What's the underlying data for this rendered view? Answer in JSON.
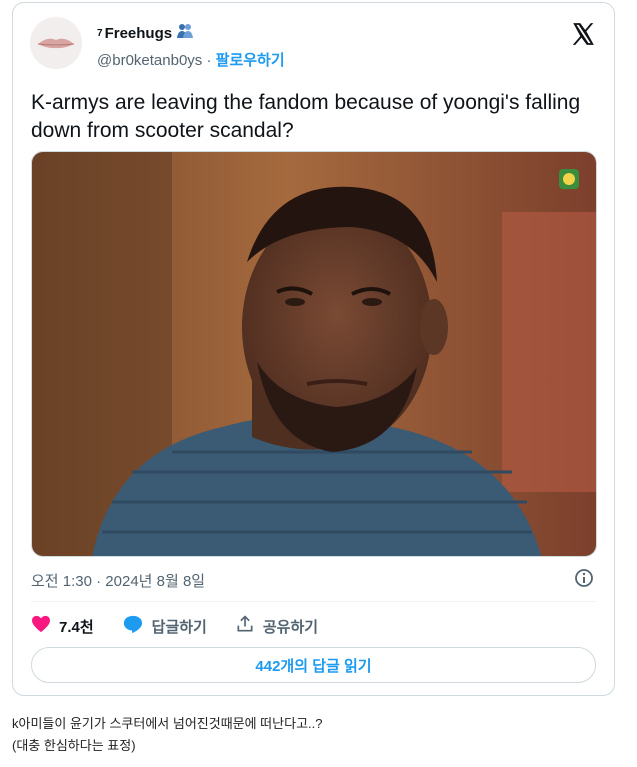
{
  "user": {
    "name_prefix": "7",
    "name": "Freehugs",
    "name_emoji": "people-hugging-icon",
    "handle": "@br0ketanb0ys",
    "separator": "·",
    "follow_label": "팔로우하기"
  },
  "tweet": {
    "text": "K-armys are leaving the fandom because of yoongi's falling down from scooter scandal?",
    "timestamp": "오전 1:30 · 2024년 8월 8일"
  },
  "actions": {
    "likes": "7.4천",
    "reply_label": "답글하기",
    "share_label": "공유하기",
    "read_replies": "442개의 답글 읽기"
  },
  "caption": {
    "line1": "k아미들이 윤기가 스쿠터에서 넘어진것때문에 떠난다고..?",
    "line2": "(대충 한심하다는 표정)"
  },
  "colors": {
    "accent": "#1d9bf0",
    "like": "#f91880",
    "muted": "#536471",
    "border": "#cfd9de"
  }
}
